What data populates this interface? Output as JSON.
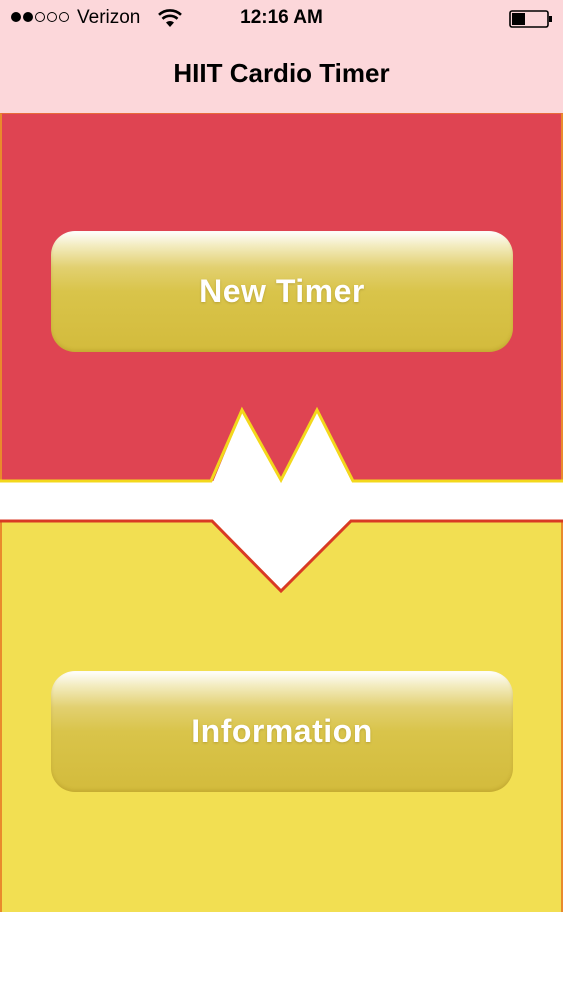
{
  "status_bar": {
    "carrier": "Verizon",
    "time": "12:16 AM",
    "signal_bars_filled": 2,
    "signal_bars_total": 5,
    "battery_level": 0.35
  },
  "nav": {
    "title": "HIIT Cardio Timer"
  },
  "buttons": {
    "new_timer": "New Timer",
    "information": "Information"
  },
  "colors": {
    "nav_background": "#fcd7da",
    "top_panel": "#df4452",
    "bottom_panel": "#f2df52",
    "button_gold": "#d6c044",
    "button_text": "#ffffff"
  }
}
